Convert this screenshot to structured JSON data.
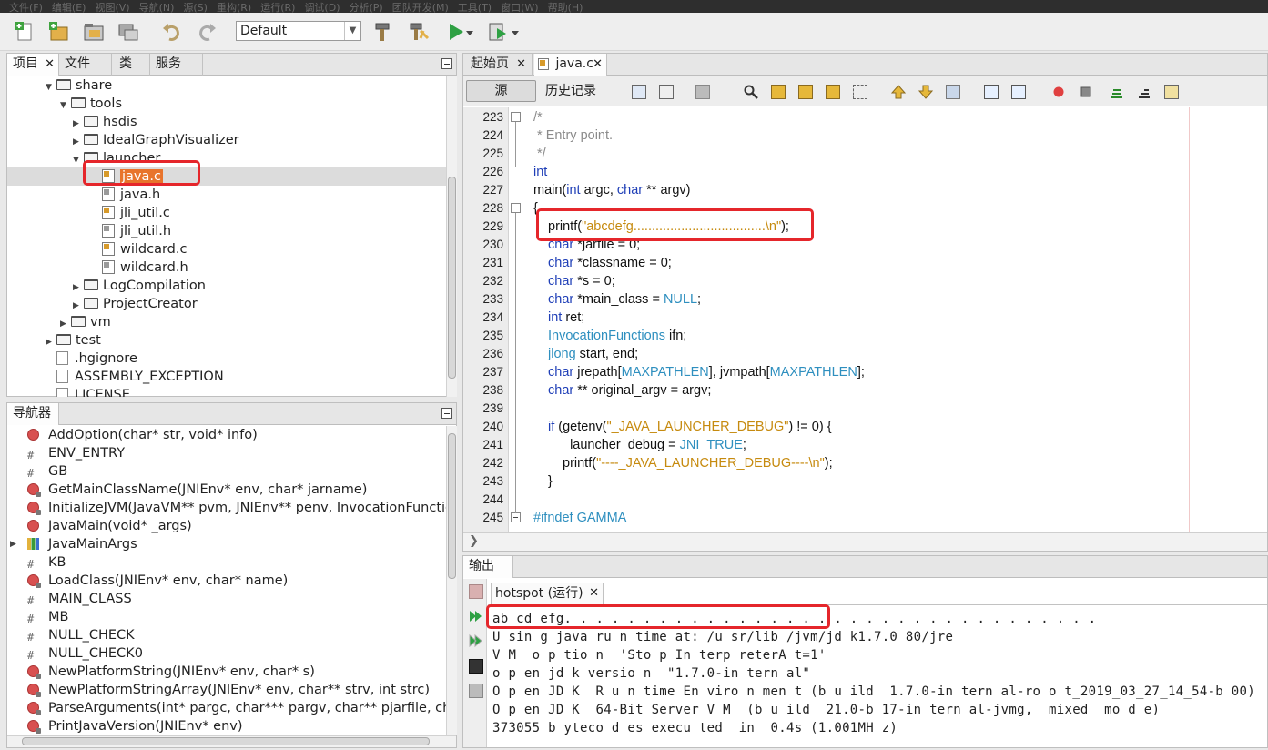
{
  "menubar": {
    "items": [
      "文件(F)",
      "编辑(E)",
      "视图(V)",
      "导航(N)",
      "源(S)",
      "重构(R)",
      "运行(R)",
      "调试(D)",
      "分析(P)",
      "团队开发(M)",
      "工具(T)",
      "窗口(W)",
      "帮助(H)"
    ]
  },
  "toolbar": {
    "config_value": "Default",
    "colors": {
      "run_green": "#2ea043",
      "red_highlight": "#e5262b"
    }
  },
  "projects_panel": {
    "tabs": [
      "项目",
      "文件",
      "类",
      "服务"
    ],
    "tree": [
      {
        "label": "share",
        "depth": 2,
        "type": "folder",
        "expanded": true
      },
      {
        "label": "tools",
        "depth": 3,
        "type": "folder",
        "expanded": true
      },
      {
        "label": "hsdis",
        "depth": 4,
        "type": "folder",
        "expanded": false
      },
      {
        "label": "IdealGraphVisualizer",
        "depth": 4,
        "type": "folder",
        "expanded": false
      },
      {
        "label": "launcher",
        "depth": 4,
        "type": "folder",
        "expanded": true
      },
      {
        "label": "java.c",
        "depth": 5,
        "type": "c",
        "selected": true
      },
      {
        "label": "java.h",
        "depth": 5,
        "type": "h"
      },
      {
        "label": "jli_util.c",
        "depth": 5,
        "type": "c"
      },
      {
        "label": "jli_util.h",
        "depth": 5,
        "type": "h"
      },
      {
        "label": "wildcard.c",
        "depth": 5,
        "type": "c"
      },
      {
        "label": "wildcard.h",
        "depth": 5,
        "type": "h"
      },
      {
        "label": "LogCompilation",
        "depth": 4,
        "type": "folder",
        "expanded": false
      },
      {
        "label": "ProjectCreator",
        "depth": 4,
        "type": "folder",
        "expanded": false
      },
      {
        "label": "vm",
        "depth": 3,
        "type": "folder",
        "expanded": false
      },
      {
        "label": "test",
        "depth": 2,
        "type": "folder",
        "expanded": false
      },
      {
        "label": ".hgignore",
        "depth": 2,
        "type": "file"
      },
      {
        "label": "ASSEMBLY_EXCEPTION",
        "depth": 2,
        "type": "file"
      },
      {
        "label": "LICENSE",
        "depth": 2,
        "type": "file"
      }
    ]
  },
  "navigator_panel": {
    "title": "导航器",
    "items": [
      {
        "label": "AddOption(char* str, void* info)",
        "icon": "fn"
      },
      {
        "label": "ENV_ENTRY",
        "icon": "hash"
      },
      {
        "label": "GB",
        "icon": "hash"
      },
      {
        "label": "GetMainClassName(JNIEnv* env, char* jarname)",
        "icon": "fn2"
      },
      {
        "label": "InitializeJVM(JavaVM** pvm, JNIEnv** penv, InvocationFunctions",
        "icon": "fn2"
      },
      {
        "label": "JavaMain(void* _args)",
        "icon": "fn"
      },
      {
        "label": "JavaMainArgs",
        "icon": "struct"
      },
      {
        "label": "KB",
        "icon": "hash"
      },
      {
        "label": "LoadClass(JNIEnv* env, char* name)",
        "icon": "fn2"
      },
      {
        "label": "MAIN_CLASS",
        "icon": "hash"
      },
      {
        "label": "MB",
        "icon": "hash"
      },
      {
        "label": "NULL_CHECK",
        "icon": "hash"
      },
      {
        "label": "NULL_CHECK0",
        "icon": "hash"
      },
      {
        "label": "NewPlatformString(JNIEnv* env, char* s)",
        "icon": "fn2"
      },
      {
        "label": "NewPlatformStringArray(JNIEnv* env, char** strv, int strc)",
        "icon": "fn2"
      },
      {
        "label": "ParseArguments(int* pargc, char*** pargv, char** pjarfile, char*",
        "icon": "fn2"
      },
      {
        "label": "PrintJavaVersion(JNIEnv* env)",
        "icon": "fn2"
      }
    ]
  },
  "editor": {
    "tabs": [
      "起始页",
      "java.c"
    ],
    "source_label": "源",
    "history_label": "历史记录",
    "lines": [
      {
        "n": "223",
        "indent": 0,
        "tokens": [
          {
            "t": "/*",
            "c": "cm"
          }
        ]
      },
      {
        "n": "224",
        "indent": 0,
        "tokens": [
          {
            "t": " * Entry point.",
            "c": "cm"
          }
        ]
      },
      {
        "n": "225",
        "indent": 0,
        "tokens": [
          {
            "t": " */",
            "c": "cm"
          }
        ]
      },
      {
        "n": "226",
        "indent": 0,
        "tokens": [
          {
            "t": "int",
            "c": "kw"
          }
        ]
      },
      {
        "n": "227",
        "indent": 0,
        "tokens": [
          {
            "t": "main(",
            "c": ""
          },
          {
            "t": "int",
            "c": "kw"
          },
          {
            "t": " argc, ",
            "c": ""
          },
          {
            "t": "char",
            "c": "kw"
          },
          {
            "t": " ** argv)",
            "c": ""
          }
        ]
      },
      {
        "n": "228",
        "indent": 0,
        "tokens": [
          {
            "t": "{",
            "c": ""
          }
        ]
      },
      {
        "n": "229",
        "indent": 1,
        "tokens": [
          {
            "t": "printf(",
            "c": ""
          },
          {
            "t": "\"abcdefg....................................\\n\"",
            "c": "str"
          },
          {
            "t": ");",
            "c": ""
          }
        ]
      },
      {
        "n": "230",
        "indent": 1,
        "tokens": [
          {
            "t": "char",
            "c": "kw"
          },
          {
            "t": " *jarfile = 0;",
            "c": ""
          }
        ]
      },
      {
        "n": "231",
        "indent": 1,
        "tokens": [
          {
            "t": "char",
            "c": "kw"
          },
          {
            "t": " *classname = 0;",
            "c": ""
          }
        ]
      },
      {
        "n": "232",
        "indent": 1,
        "tokens": [
          {
            "t": "char",
            "c": "kw"
          },
          {
            "t": " *s = 0;",
            "c": ""
          }
        ]
      },
      {
        "n": "233",
        "indent": 1,
        "tokens": [
          {
            "t": "char",
            "c": "kw"
          },
          {
            "t": " *main_class = ",
            "c": ""
          },
          {
            "t": "NULL",
            "c": "ty"
          },
          {
            "t": ";",
            "c": ""
          }
        ]
      },
      {
        "n": "234",
        "indent": 1,
        "tokens": [
          {
            "t": "int",
            "c": "kw"
          },
          {
            "t": " ret;",
            "c": ""
          }
        ]
      },
      {
        "n": "235",
        "indent": 1,
        "tokens": [
          {
            "t": "InvocationFunctions",
            "c": "ty"
          },
          {
            "t": " ifn;",
            "c": ""
          }
        ]
      },
      {
        "n": "236",
        "indent": 1,
        "tokens": [
          {
            "t": "jlong",
            "c": "ty"
          },
          {
            "t": " start, end;",
            "c": ""
          }
        ]
      },
      {
        "n": "237",
        "indent": 1,
        "tokens": [
          {
            "t": "char",
            "c": "kw"
          },
          {
            "t": " jrepath[",
            "c": ""
          },
          {
            "t": "MAXPATHLEN",
            "c": "ty"
          },
          {
            "t": "], jvmpath[",
            "c": ""
          },
          {
            "t": "MAXPATHLEN",
            "c": "ty"
          },
          {
            "t": "];",
            "c": ""
          }
        ]
      },
      {
        "n": "238",
        "indent": 1,
        "tokens": [
          {
            "t": "char",
            "c": "kw"
          },
          {
            "t": " ** original_argv = argv;",
            "c": ""
          }
        ]
      },
      {
        "n": "239",
        "indent": 0,
        "tokens": []
      },
      {
        "n": "240",
        "indent": 1,
        "tokens": [
          {
            "t": "if",
            "c": "kw"
          },
          {
            "t": " (getenv(",
            "c": ""
          },
          {
            "t": "\"_JAVA_LAUNCHER_DEBUG\"",
            "c": "str"
          },
          {
            "t": ") != 0) {",
            "c": ""
          }
        ]
      },
      {
        "n": "241",
        "indent": 2,
        "tokens": [
          {
            "t": "_launcher_debug = ",
            "c": ""
          },
          {
            "t": "JNI_TRUE",
            "c": "ty"
          },
          {
            "t": ";",
            "c": ""
          }
        ]
      },
      {
        "n": "242",
        "indent": 2,
        "tokens": [
          {
            "t": "printf(",
            "c": ""
          },
          {
            "t": "\"----_JAVA_LAUNCHER_DEBUG----\\n\"",
            "c": "str"
          },
          {
            "t": ");",
            "c": ""
          }
        ]
      },
      {
        "n": "243",
        "indent": 1,
        "tokens": [
          {
            "t": "}",
            "c": ""
          }
        ]
      },
      {
        "n": "244",
        "indent": 0,
        "tokens": []
      },
      {
        "n": "245",
        "indent": 0,
        "tokens": [
          {
            "t": "#ifndef GAMMA",
            "c": "ty"
          }
        ]
      }
    ]
  },
  "output": {
    "title": "输出",
    "run_tab": "hotspot (运行)",
    "lines": [
      "ab cd efg. . . . . . . . . . . . . . . . . . . . . . . . . . . . . . . . . .",
      "U sin g java ru n time at: /u sr/lib /jvm/jd k1.7.0_80/jre",
      "V M  o p tio n  'Sto p In terp reterA t=1'",
      "o p en jd k versio n  \"1.7.0-in tern al\"",
      "O p en JD K  R u n time En viro n men t (b u ild  1.7.0-in tern al-ro o t_2019_03_27_14_54-b 00)",
      "O p en JD K  64-Bit Server V M  (b u ild  21.0-b 17-in tern al-jvmg,  mixed  mo d e)",
      "373055 b yteco d es execu ted  in  0.4s (1.001MH z)"
    ]
  }
}
